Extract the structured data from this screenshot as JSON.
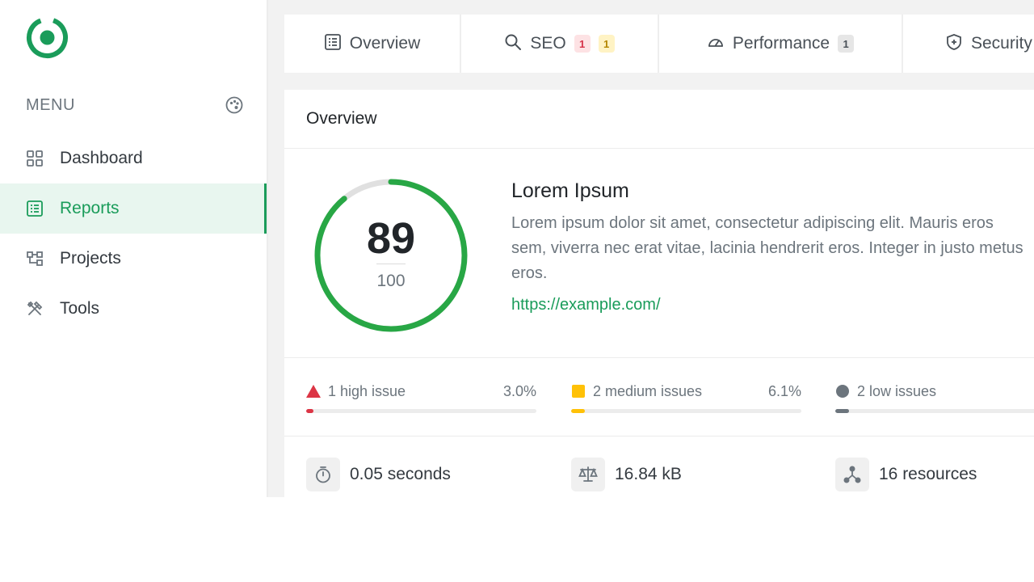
{
  "sidebar": {
    "menu_title": "MENU",
    "items": [
      {
        "label": "Dashboard",
        "icon": "grid-icon",
        "active": false
      },
      {
        "label": "Reports",
        "icon": "report-icon",
        "active": true
      },
      {
        "label": "Projects",
        "icon": "projects-icon",
        "active": false
      },
      {
        "label": "Tools",
        "icon": "tools-icon",
        "active": false
      }
    ]
  },
  "tabs": [
    {
      "label": "Overview",
      "icon": "report-icon",
      "badges": []
    },
    {
      "label": "SEO",
      "icon": "search-icon",
      "badges": [
        "1",
        "1"
      ]
    },
    {
      "label": "Performance",
      "icon": "speedometer-icon",
      "badges": [
        "1"
      ]
    },
    {
      "label": "Security",
      "icon": "shield-icon",
      "badges": []
    }
  ],
  "card": {
    "title": "Overview",
    "score": "89",
    "max": "100",
    "score_fraction": 0.89,
    "site_title": "Lorem Ipsum",
    "description": "Lorem ipsum dolor sit amet, consectetur adipiscing elit. Mauris eros sem, viverra nec erat vitae, lacinia hendrerit eros. Integer in justo metus eros.",
    "url": "https://example.com/"
  },
  "issues": [
    {
      "label": "1 high issue",
      "percent": "3.0%",
      "fraction": 0.03,
      "color": "#dc3545",
      "marker": "triangle"
    },
    {
      "label": "2 medium issues",
      "percent": "6.1%",
      "fraction": 0.061,
      "color": "#ffc107",
      "marker": "square"
    },
    {
      "label": "2 low issues",
      "percent": "",
      "fraction": 0.061,
      "color": "#6c757d",
      "marker": "circle"
    }
  ],
  "stats": [
    {
      "value": "0.05 seconds",
      "icon": "stopwatch-icon"
    },
    {
      "value": "16.84 kB",
      "icon": "scale-icon"
    },
    {
      "value": "16 resources",
      "icon": "share-nodes-icon"
    }
  ],
  "colors": {
    "accent": "#1a9c5a",
    "gauge": "#28a745",
    "gauge_track": "#e0e0e0"
  }
}
